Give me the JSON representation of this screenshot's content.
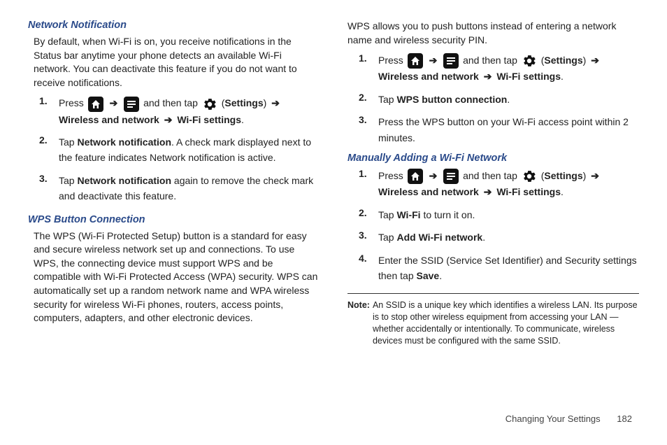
{
  "icons": {
    "home": "home-icon",
    "menu": "menu-icon",
    "settings": "gear-icon"
  },
  "left": {
    "section1": {
      "heading": "Network Notification",
      "body": "By default, when Wi-Fi is on, you receive notifications in the Status bar anytime your phone detects an available Wi-Fi network. You can deactivate this feature if you do not want to receive notifications.",
      "steps": [
        {
          "num": "1.",
          "pre": "Press ",
          "mid": " and then tap ",
          "settings_label": "Settings",
          "trail_bold": "Wireless and network",
          "trail_bold2": "Wi-Fi settings",
          "trail_period": "."
        },
        {
          "num": "2.",
          "pre": "Tap ",
          "bold": "Network notification",
          "post": ". A check mark displayed next to the feature indicates Network notification is active."
        },
        {
          "num": "3.",
          "pre": "Tap ",
          "bold": "Network notification",
          "post": " again to remove the check mark and deactivate this feature."
        }
      ]
    },
    "section2": {
      "heading": "WPS Button Connection",
      "body": "The WPS (Wi-Fi Protected Setup) button is a standard for easy and secure wireless network set up and connections. To use WPS, the connecting device must support WPS and be compatible with Wi-Fi Protected Access (WPA) security. WPS can automatically set up a random network name and WPA wireless security for wireless Wi-Fi phones, routers, access points, computers, adapters, and other electronic devices."
    }
  },
  "right": {
    "intro": "WPS allows you to push buttons instead of entering a network name and wireless security PIN.",
    "steps_a": [
      {
        "num": "1.",
        "pre": "Press ",
        "mid": " and then tap ",
        "settings_label": "Settings",
        "trail_bold": "Wireless and network",
        "trail_bold2": "Wi-Fi settings",
        "trail_period": "."
      },
      {
        "num": "2.",
        "pre": "Tap ",
        "bold": "WPS button connection",
        "post": "."
      },
      {
        "num": "3.",
        "text": "Press the WPS button on your Wi-Fi access point within 2 minutes."
      }
    ],
    "section3": {
      "heading": "Manually Adding a Wi-Fi Network",
      "steps": [
        {
          "num": "1.",
          "pre": "Press ",
          "mid": " and then tap ",
          "settings_label": "Settings",
          "trail_bold": "Wireless and network",
          "trail_bold2": "Wi-Fi settings",
          "trail_period": "."
        },
        {
          "num": "2.",
          "pre": "Tap ",
          "bold": "Wi-Fi",
          "post": " to turn it on."
        },
        {
          "num": "3.",
          "pre": "Tap ",
          "bold": "Add Wi-Fi network",
          "post": "."
        },
        {
          "num": "4.",
          "pre": "Enter the SSID (Service Set Identifier) and Security settings then tap ",
          "bold": "Save",
          "post": "."
        }
      ]
    },
    "note": {
      "label": "Note:",
      "text": "An SSID is a unique key which identifies a wireless LAN. Its purpose is to stop other wireless equipment from accessing your LAN — whether accidentally or intentionally. To communicate, wireless devices must be configured with the same SSID."
    }
  },
  "footer": {
    "title": "Changing Your Settings",
    "page": "182"
  },
  "arrow": "➔"
}
